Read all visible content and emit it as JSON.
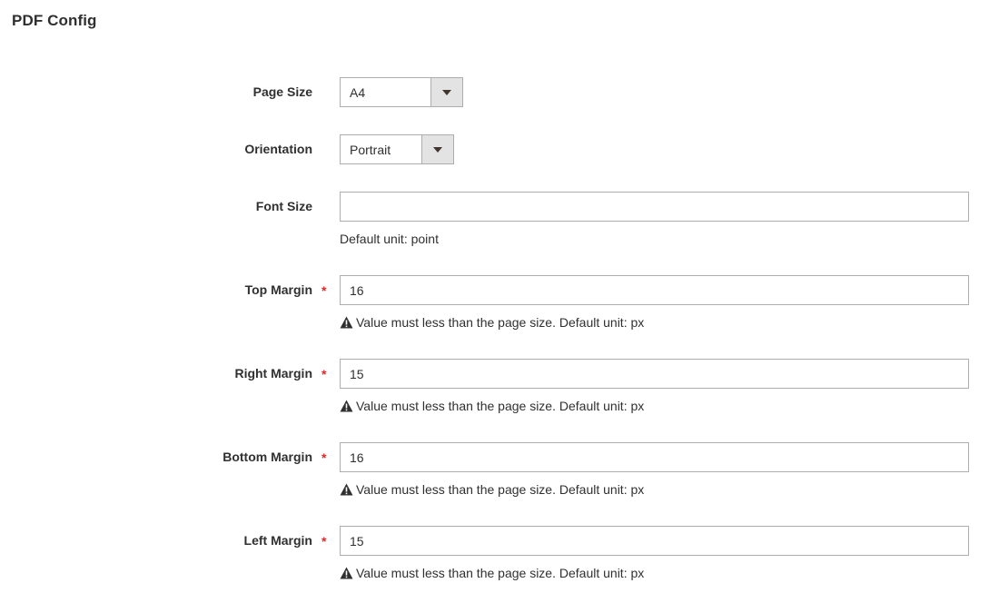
{
  "section": {
    "title": "PDF Config"
  },
  "fields": {
    "page_size": {
      "label": "Page Size",
      "value": "A4"
    },
    "orientation": {
      "label": "Orientation",
      "value": "Portrait"
    },
    "font_size": {
      "label": "Font Size",
      "value": "",
      "note": "Default unit: point"
    },
    "top_margin": {
      "label": "Top Margin",
      "required_mark": "*",
      "value": "16",
      "note": "Value must less than the page size. Default unit: px"
    },
    "right_margin": {
      "label": "Right Margin",
      "required_mark": "*",
      "value": "15",
      "note": "Value must less than the page size. Default unit: px"
    },
    "bottom_margin": {
      "label": "Bottom Margin",
      "required_mark": "*",
      "value": "16",
      "note": "Value must less than the page size. Default unit: px"
    },
    "left_margin": {
      "label": "Left Margin",
      "required_mark": "*",
      "value": "15",
      "note": "Value must less than the page size. Default unit: px"
    }
  },
  "colors": {
    "required": "#e22626",
    "border": "#adadad",
    "select_arrow_bg": "#e3e3e3",
    "text": "#303030"
  },
  "icons": {
    "select_arrow": "triangle-down-icon",
    "note_warning": "warning-triangle-icon"
  }
}
